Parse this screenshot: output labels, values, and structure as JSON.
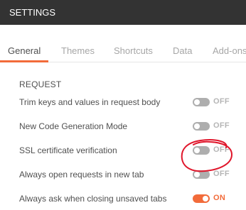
{
  "window": {
    "title": "SETTINGS"
  },
  "tabs": [
    {
      "label": "General",
      "active": true
    },
    {
      "label": "Themes",
      "active": false
    },
    {
      "label": "Shortcuts",
      "active": false
    },
    {
      "label": "Data",
      "active": false
    },
    {
      "label": "Add-ons",
      "active": false
    }
  ],
  "section": {
    "title": "REQUEST"
  },
  "settings": [
    {
      "label": "Trim keys and values in request body",
      "state": "OFF",
      "on": false
    },
    {
      "label": "New Code Generation Mode",
      "state": "OFF",
      "on": false
    },
    {
      "label": "SSL certificate verification",
      "state": "OFF",
      "on": false
    },
    {
      "label": "Always open requests in new tab",
      "state": "OFF",
      "on": false
    },
    {
      "label": "Always ask when closing unsaved tabs",
      "state": "ON",
      "on": true
    }
  ],
  "colors": {
    "titlebar": "#333333",
    "accent": "#f26b3a",
    "toggle_off": "#aeaeae",
    "annotation": "#e0162b"
  }
}
